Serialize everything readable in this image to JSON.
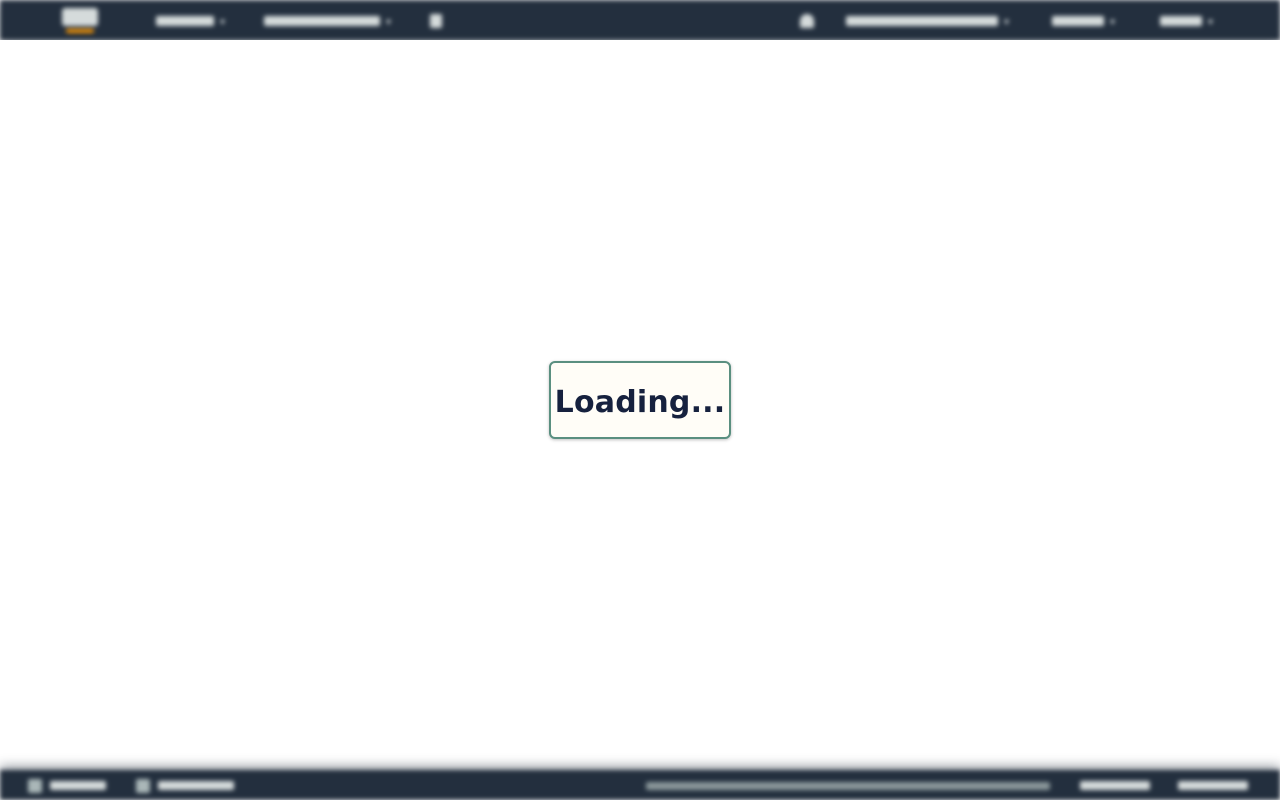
{
  "top_nav": {
    "background_color": "#232f3e",
    "logo_icon": "brand-logo-icon",
    "services_icon": "chevron-down-icon",
    "resource_groups_icon": "chevron-down-icon",
    "pin_icon": "pin-icon",
    "bell_icon": "bell-icon"
  },
  "footer": {
    "background_color": "#232f3e",
    "feedback_icon": "feedback-icon",
    "language_icon": "globe-icon"
  },
  "loading": {
    "text": "Loading..."
  },
  "colors": {
    "accent": "#ff9900",
    "loading_border": "#5a8f80",
    "loading_text": "#16213e"
  }
}
